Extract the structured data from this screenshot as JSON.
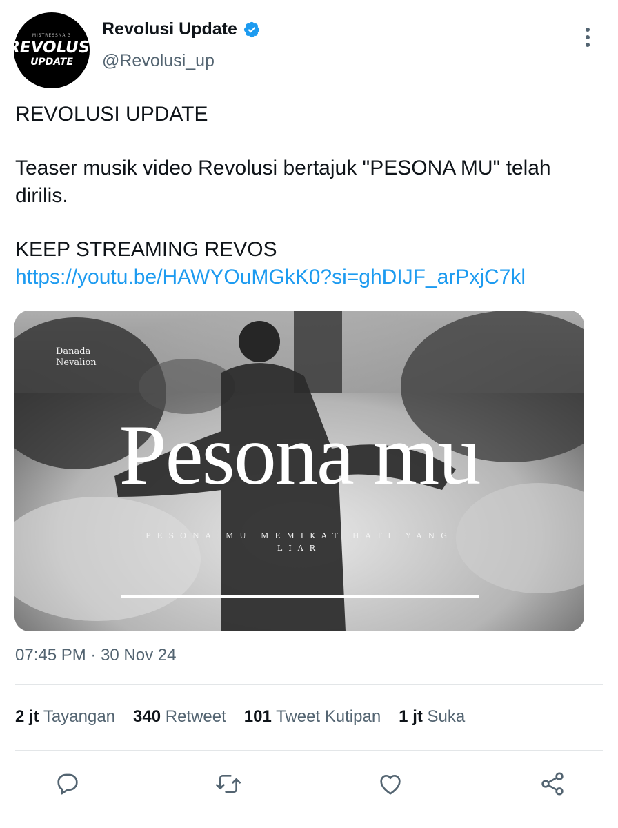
{
  "author": {
    "display_name": "Revolusi Update",
    "handle": "@Revolusi_up",
    "avatar_small_text": "MISTRESSNA 3",
    "avatar_main_text": "REVOLUSI",
    "avatar_sub_text": "UPDATE",
    "verified_icon": "verified-badge-icon",
    "verified_color": "#1d9bf0"
  },
  "tweet": {
    "line1": "REVOLUSI UPDATE",
    "line2": "Teaser musik video Revolusi bertajuk \"PESONA MU\" telah dirilis.",
    "line3": "KEEP STREAMING REVOS",
    "link": "https://youtu.be/HAWYOuMGkK0?si=ghDIJF_arPxjC7kl",
    "link_color": "#1d9bf0"
  },
  "media": {
    "artist_line1": "Danada",
    "artist_line2": "Nevalion",
    "title": "Pesona mu",
    "caption_line1": "PESONA MU MEMIKAT HATI YANG",
    "caption_line2": "LIAR"
  },
  "meta": {
    "timestamp": "07:45 PM · 30 Nov 24"
  },
  "stats": {
    "views_count": "2 jt",
    "views_label": "Tayangan",
    "retweets_count": "340",
    "retweets_label": "Retweet",
    "quotes_count": "101",
    "quotes_label": "Tweet Kutipan",
    "likes_count": "1 jt",
    "likes_label": "Suka"
  },
  "actions": [
    "reply-icon",
    "retweet-icon",
    "like-icon",
    "share-icon"
  ],
  "colors": {
    "secondary_text": "#536471",
    "icon": "#536471"
  }
}
